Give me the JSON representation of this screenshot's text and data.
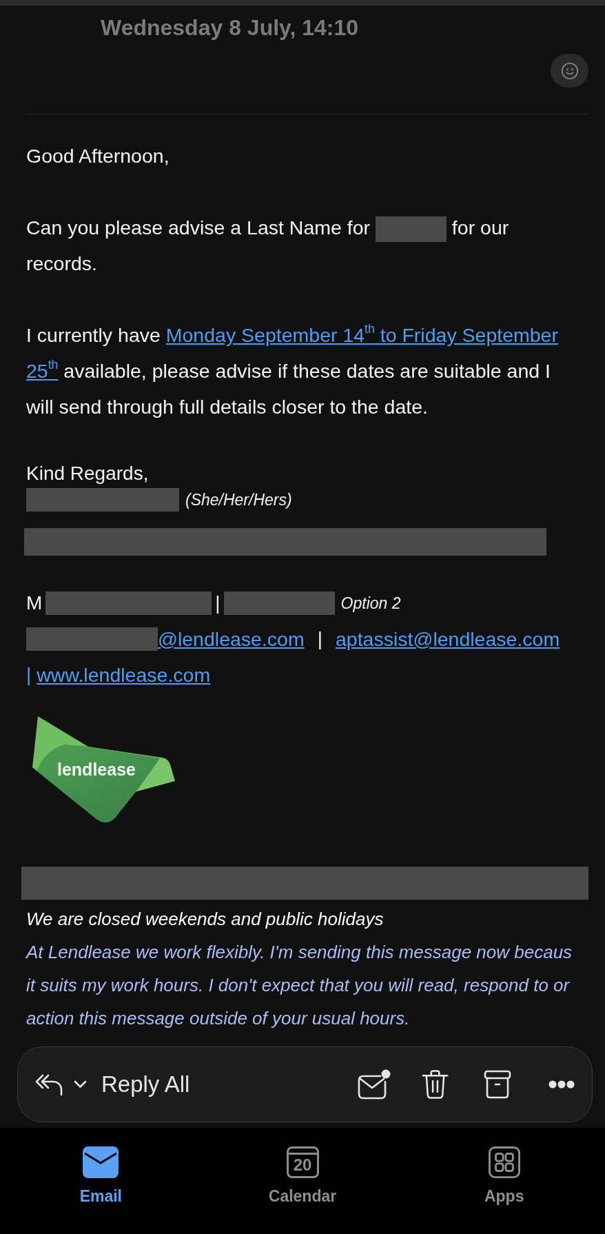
{
  "header": {
    "date": "Wednesday 8 July, 14:10"
  },
  "message": {
    "paragraphs": [
      {
        "segments": [
          {
            "kind": "text",
            "text": "Good Afternoon,"
          }
        ]
      },
      {
        "segments": [
          {
            "kind": "text",
            "text": "Can you please advise a Last Name for "
          },
          {
            "kind": "redacted"
          },
          {
            "kind": "text",
            "text": " for our records."
          }
        ]
      },
      {
        "segments": [
          {
            "kind": "text",
            "text": "I currently have "
          },
          {
            "kind": "link",
            "text": "Monday September 14$^{th}$ to Friday September"
          },
          {
            "kind": "link",
            "text": "25$^{th}$"
          },
          {
            "kind": "text",
            "text": " available, please advise if these dates are suitable and I will send through full details closer to the date."
          }
        ]
      }
    ]
  },
  "signature": {
    "lines": [
      {
        "segments": [
          {
            "kind": "text",
            "text": "Kind Regards,"
          }
        ]
      },
      {
        "segments": [
          {
            "kind": "redacted"
          },
          {
            "kind": "note",
            "text": "(She/Her/Hers)"
          }
        ]
      },
      {
        "segments": [
          {
            "kind": "redacted_bar"
          }
        ]
      },
      {
        "segments": [
          {
            "kind": "text",
            "text": "M"
          },
          {
            "kind": "redacted"
          },
          {
            "kind": "separator",
            "text": "|"
          },
          {
            "kind": "redacted"
          },
          {
            "kind": "note",
            "text": "Option 2"
          }
        ]
      },
      {
        "segments": [
          {
            "kind": "redacted"
          },
          {
            "kind": "link",
            "text": "@lendlease.com"
          },
          {
            "kind": "separator",
            "text": "|"
          },
          {
            "kind": "link",
            "text": "aptassist@lendlease.com"
          }
        ]
      },
      {
        "segments": [
          {
            "kind": "link_separator",
            "text": "|"
          },
          {
            "kind": "link",
            "text": "www.lendlease.com"
          }
        ]
      }
    ]
  },
  "logo": {
    "text": "lendlease"
  },
  "notice": {
    "redacted_banner": true,
    "heading": "We are closed weekends and public holidays",
    "lines": [
      "At Lendlease we work flexibly. I'm sending this message now becaus",
      "it suits my work hours. I don't expect that you will read, respond to or",
      "action this message outside of your usual hours."
    ]
  },
  "toolbar": {
    "reply_label": "Reply All"
  },
  "tabs": [
    {
      "kind": "email",
      "label": "Email",
      "selected": true
    },
    {
      "kind": "calendar",
      "label": "Calendar",
      "date": "20",
      "selected": false
    },
    {
      "kind": "apps",
      "label": "Apps",
      "selected": false
    }
  ]
}
